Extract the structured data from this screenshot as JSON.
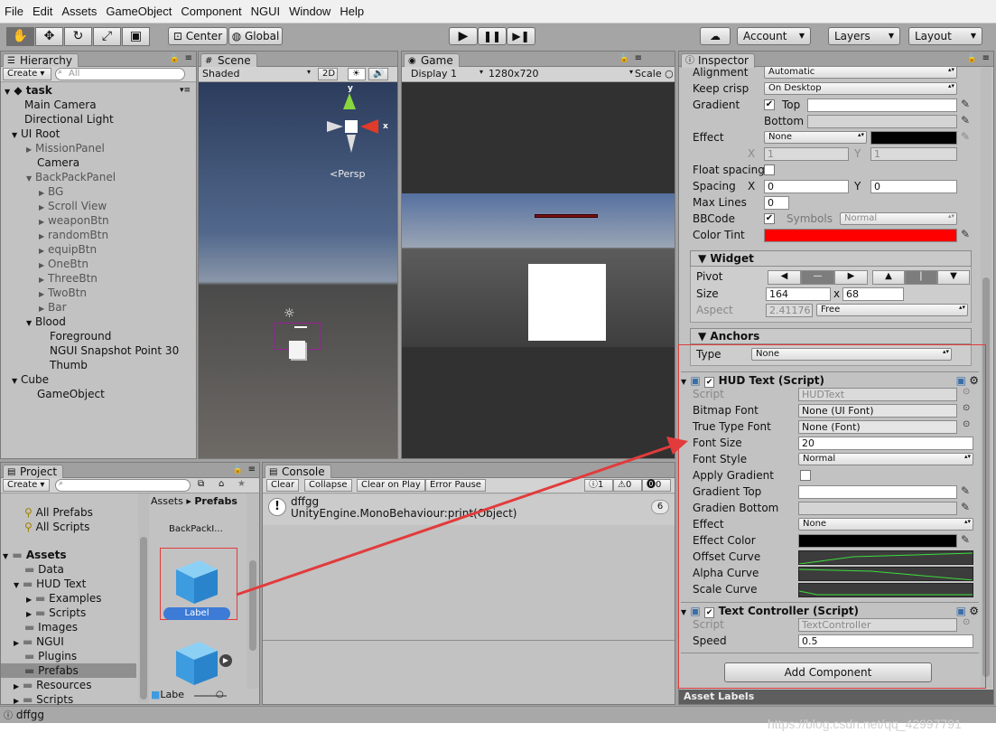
{
  "menu": [
    "File",
    "Edit",
    "Assets",
    "GameObject",
    "Component",
    "NGUI",
    "Window",
    "Help"
  ],
  "toolbar": {
    "center": "Center",
    "global": "Global",
    "account": "Account",
    "layers": "Layers",
    "layout": "Layout"
  },
  "hierarchy": {
    "tab": "Hierarchy",
    "create": "Create",
    "search_placeholder": "All",
    "scene": "task",
    "items": [
      "Main Camera",
      "Directional Light",
      "UI Root",
      "MissionPanel",
      "Camera",
      "BackPackPanel",
      "BG",
      "Scroll View",
      "weaponBtn",
      "randomBtn",
      "equipBtn",
      "OneBtn",
      "ThreeBtn",
      "TwoBtn",
      "Bar",
      "Blood",
      "Foreground",
      "NGUI Snapshot Point 30",
      "Thumb",
      "Cube",
      "GameObject"
    ]
  },
  "scene": {
    "tab": "Scene",
    "shading": "Shaded",
    "mode2d": "2D",
    "persp": "Persp",
    "axis_y": "y",
    "axis_x": "x"
  },
  "game": {
    "tab": "Game",
    "display": "Display 1",
    "resolution": "1280x720",
    "scale": "Scale"
  },
  "project": {
    "tab": "Project",
    "create": "Create",
    "favorites": [
      "All Prefabs",
      "All Scripts"
    ],
    "assets_root": "Assets",
    "folders": [
      "Data",
      "HUD Text",
      "Examples",
      "Scripts",
      "Images",
      "NGUI",
      "Plugins",
      "Prefabs",
      "Resources",
      "Scripts"
    ],
    "breadcrumb_root": "Assets",
    "breadcrumb_sep": "▸",
    "breadcrumb_cur": "Prefabs",
    "prefab_top": "BackPackI...",
    "prefab_label": "Label",
    "prefab_bottom": "Labe"
  },
  "console": {
    "tab": "Console",
    "clear": "Clear",
    "collapse": "Collapse",
    "clear_on_play": "Clear on Play",
    "error_pause": "Error Pause",
    "count_info": "1",
    "count_warn": "0",
    "count_err": "0",
    "msg_line1": "dffgg",
    "msg_line2": "UnityEngine.MonoBehaviour:print(Object)",
    "msg_count": "6"
  },
  "inspector": {
    "tab": "Inspector",
    "alignment_label": "Alignment",
    "alignment_val": "Automatic",
    "keepcrisp_label": "Keep crisp",
    "keepcrisp_val": "On Desktop",
    "gradient_label": "Gradient",
    "top_label": "Top",
    "bottom_label": "Bottom",
    "effect_label": "Effect",
    "effect_val": "None",
    "x_label": "X",
    "y_label": "Y",
    "effect_x": "1",
    "effect_y": "1",
    "floatspacing_label": "Float spacing",
    "spacing_label": "Spacing",
    "spacing_x": "0",
    "spacing_y": "0",
    "maxlines_label": "Max Lines",
    "maxlines_val": "0",
    "bbcode_label": "BBCode",
    "symbols_label": "Symbols",
    "symbols_val": "Normal",
    "colortint_label": "Color Tint",
    "widget_title": "Widget",
    "pivot_label": "Pivot",
    "size_label": "Size",
    "size_w": "164",
    "size_x": "x",
    "size_h": "68",
    "aspect_label": "Aspect",
    "aspect_val": "2.41176",
    "aspect_mode": "Free",
    "anchors_title": "Anchors",
    "type_label": "Type",
    "type_val": "None",
    "hud_title": "HUD Text (Script)",
    "script_label": "Script",
    "hud_script": "HUDText",
    "bitmapfont_label": "Bitmap Font",
    "bitmapfont_val": "None (UI Font)",
    "truetype_label": "True Type Font",
    "truetype_val": "None (Font)",
    "fontsize_label": "Font Size",
    "fontsize_val": "20",
    "fontstyle_label": "Font Style",
    "fontstyle_val": "Normal",
    "applygradient_label": "Apply Gradient",
    "gradtop_label": "Gradient Top",
    "gradbottom_label": "Gradien Bottom",
    "effect2_label": "Effect",
    "effect2_val": "None",
    "effectcolor_label": "Effect Color",
    "offsetcurve_label": "Offset Curve",
    "alphacurve_label": "Alpha Curve",
    "scalecurve_label": "Scale Curve",
    "tc_title": "Text Controller (Script)",
    "tc_script": "TextController",
    "speed_label": "Speed",
    "speed_val": "0.5",
    "add_component": "Add Component",
    "asset_labels": "Asset Labels"
  },
  "statusbar": {
    "text": "dffgg"
  },
  "watermark": "https://blog.csdn.net/qq_42997791",
  "colors": {
    "color_tint": "#ff0000",
    "annotation": "#e23b3b",
    "effect_color": "#000000"
  }
}
